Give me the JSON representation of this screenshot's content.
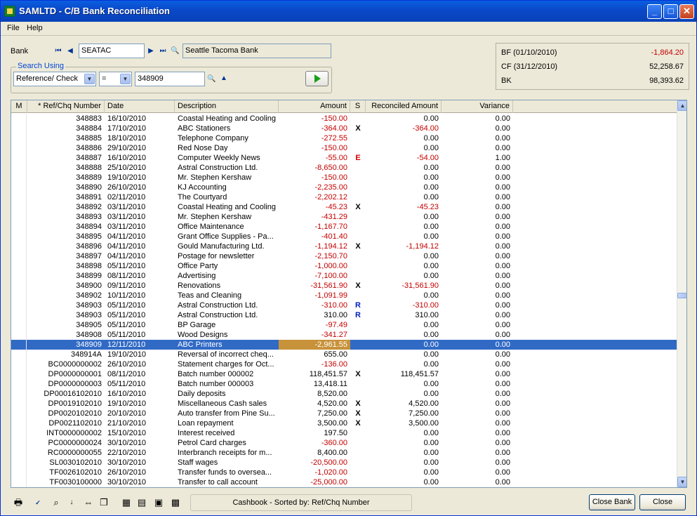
{
  "window": {
    "title": "SAMLTD - C/B Bank Reconciliation",
    "min": "_",
    "max": "□",
    "close": "✕"
  },
  "menu": {
    "file": "File",
    "help": "Help"
  },
  "bank": {
    "label": "Bank",
    "code": "SEATAC",
    "name": "Seattle Tacoma Bank",
    "first_icon": "first-icon",
    "prev_icon": "prev-icon",
    "next_icon": "next-icon",
    "last_icon": "last-icon",
    "search_icon": "magnifier-icon"
  },
  "search": {
    "legend": "Search Using",
    "field": "Reference/ Check",
    "operator": "=",
    "value": "348909",
    "go_icon": "go-arrow-icon"
  },
  "balances": {
    "bf_label": "BF (01/10/2010)",
    "bf_value": "-1,864.20",
    "cf_label": "CF (31/12/2010)",
    "cf_value": "52,258.67",
    "bk_label": "BK",
    "bk_value": "98,393.62"
  },
  "grid": {
    "headers": {
      "m": "M",
      "ref": "* Ref/Chq Number",
      "date": "Date",
      "desc": "Description",
      "amount": "Amount",
      "s": "S",
      "rec": "Reconciled Amount",
      "var": "Variance"
    },
    "rows": [
      [
        "348883",
        "16/10/2010",
        "Coastal Heating and Cooling",
        "-150.00",
        "",
        "0.00",
        "0.00"
      ],
      [
        "348884",
        "17/10/2010",
        "ABC Stationers",
        "-364.00",
        "X",
        "-364.00",
        "0.00"
      ],
      [
        "348885",
        "18/10/2010",
        "Telephone Company",
        "-272.55",
        "",
        "0.00",
        "0.00"
      ],
      [
        "348886",
        "29/10/2010",
        "Red Nose Day",
        "-150.00",
        "",
        "0.00",
        "0.00"
      ],
      [
        "348887",
        "16/10/2010",
        "Computer Weekly News",
        "-55.00",
        "E",
        "-54.00",
        "1.00"
      ],
      [
        "348888",
        "25/10/2010",
        "Astral Construction Ltd.",
        "-8,650.00",
        "",
        "0.00",
        "0.00"
      ],
      [
        "348889",
        "19/10/2010",
        "Mr. Stephen Kershaw",
        "-150.00",
        "",
        "0.00",
        "0.00"
      ],
      [
        "348890",
        "26/10/2010",
        "KJ Accounting",
        "-2,235.00",
        "",
        "0.00",
        "0.00"
      ],
      [
        "348891",
        "02/11/2010",
        "The Courtyard",
        "-2,202.12",
        "",
        "0.00",
        "0.00"
      ],
      [
        "348892",
        "03/11/2010",
        "Coastal Heating and Cooling",
        "-45.23",
        "X",
        "-45.23",
        "0.00"
      ],
      [
        "348893",
        "03/11/2010",
        "Mr. Stephen Kershaw",
        "-431.29",
        "",
        "0.00",
        "0.00"
      ],
      [
        "348894",
        "03/11/2010",
        "Office Maintenance",
        "-1,167.70",
        "",
        "0.00",
        "0.00"
      ],
      [
        "348895",
        "04/11/2010",
        "Grant Office Supplies - Pa...",
        "-401.40",
        "",
        "0.00",
        "0.00"
      ],
      [
        "348896",
        "04/11/2010",
        "Gould Manufacturing Ltd.",
        "-1,194.12",
        "X",
        "-1,194.12",
        "0.00"
      ],
      [
        "348897",
        "04/11/2010",
        "Postage for newsletter",
        "-2,150.70",
        "",
        "0.00",
        "0.00"
      ],
      [
        "348898",
        "05/11/2010",
        "Office Party",
        "-1,000.00",
        "",
        "0.00",
        "0.00"
      ],
      [
        "348899",
        "08/11/2010",
        "Advertising",
        "-7,100.00",
        "",
        "0.00",
        "0.00"
      ],
      [
        "348900",
        "09/11/2010",
        "Renovations",
        "-31,561.90",
        "X",
        "-31,561.90",
        "0.00"
      ],
      [
        "348902",
        "10/11/2010",
        "Teas and Cleaning",
        "-1,091.99",
        "",
        "0.00",
        "0.00"
      ],
      [
        "348903",
        "05/11/2010",
        "Astral Construction Ltd.",
        "-310.00",
        "R",
        "-310.00",
        "0.00"
      ],
      [
        "348903",
        "05/11/2010",
        "Astral Construction Ltd.",
        "310.00",
        "R",
        "310.00",
        "0.00"
      ],
      [
        "348905",
        "05/11/2010",
        "BP Garage",
        "-97.49",
        "",
        "0.00",
        "0.00"
      ],
      [
        "348908",
        "05/11/2010",
        "Wood Designs",
        "-341.27",
        "",
        "0.00",
        "0.00"
      ],
      [
        "348909",
        "12/11/2010",
        "ABC Printers",
        "-2,961.55",
        "",
        "0.00",
        "0.00"
      ],
      [
        "348914A",
        "19/10/2010",
        "Reversal of incorrect cheq...",
        "655.00",
        "",
        "0.00",
        "0.00"
      ],
      [
        "BC0000000002",
        "26/10/2010",
        "Statement charges for Oct...",
        "-136.00",
        "",
        "0.00",
        "0.00"
      ],
      [
        "DP0000000001",
        "08/11/2010",
        "Batch number 000002",
        "118,451.57",
        "X",
        "118,451.57",
        "0.00"
      ],
      [
        "DP0000000003",
        "05/11/2010",
        "Batch number 000003",
        "13,418.11",
        "",
        "0.00",
        "0.00"
      ],
      [
        "DP00016102010",
        "16/10/2010",
        "Daily deposits",
        "8,520.00",
        "",
        "0.00",
        "0.00"
      ],
      [
        "DP0019102010",
        "19/10/2010",
        "Miscellaneous Cash sales",
        "4,520.00",
        "X",
        "4,520.00",
        "0.00"
      ],
      [
        "DP0020102010",
        "20/10/2010",
        "Auto transfer from Pine Su...",
        "7,250.00",
        "X",
        "7,250.00",
        "0.00"
      ],
      [
        "DP0021102010",
        "21/10/2010",
        "Loan repayment",
        "3,500.00",
        "X",
        "3,500.00",
        "0.00"
      ],
      [
        "INT0000000002",
        "15/10/2010",
        "Interest received",
        "197.50",
        "",
        "0.00",
        "0.00"
      ],
      [
        "PC0000000024",
        "30/10/2010",
        "Petrol Card charges",
        "-360.00",
        "",
        "0.00",
        "0.00"
      ],
      [
        "RC0000000055",
        "22/10/2010",
        "Interbranch receipts for m...",
        "8,400.00",
        "",
        "0.00",
        "0.00"
      ],
      [
        "SL0030102010",
        "30/10/2010",
        "Staff wages",
        "-20,500.00",
        "",
        "0.00",
        "0.00"
      ],
      [
        "TF0026102010",
        "26/10/2010",
        "Transfer funds to oversea...",
        "-1,020.00",
        "",
        "0.00",
        "0.00"
      ],
      [
        "TF0030100000",
        "30/10/2010",
        "Transfer to call account",
        "-25,000.00",
        "",
        "0.00",
        "0.00"
      ]
    ],
    "selected_index": 23
  },
  "footer": {
    "status": "Cashbook - Sorted by: Ref/Chq Number",
    "close_bank": "Close Bank",
    "close": "Close",
    "icons": [
      "printer-icon",
      "recalc-icon",
      "binoculars-icon",
      "sort-az-icon",
      "fit-columns-icon",
      "copy-icon",
      "calendar-icon",
      "notes-icon",
      "export-icon",
      "calculator-icon"
    ]
  },
  "colors": {
    "negative": "#c40000",
    "selection": "#316ac5",
    "selected_amount": "#c8923a"
  }
}
